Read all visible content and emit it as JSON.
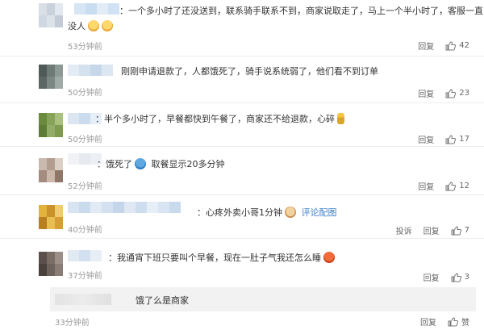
{
  "colors": {
    "link": "#3a7ec8",
    "muted": "#999999",
    "divider": "#eeeeee"
  },
  "comments": [
    {
      "text_a": "：一个多小时了还没送到，联系骑手联系不到，商家说取走了，马上一个半小时了，客服一直",
      "text_b": "没人",
      "emojis": [
        "crying-face-icon",
        "crying-face-icon"
      ],
      "time": "53分钟前",
      "reply": "回复",
      "likes": "42"
    },
    {
      "text_a": "刚刚申请退款了，人都饿死了，骑手说系统弱了，他们看不到订单",
      "time": "50分钟前",
      "reply": "回复",
      "likes": "23"
    },
    {
      "text_a": "：半个多小时了，早餐都快到午餐了，商家还不给退款，心碎",
      "emojis": [
        "candle-icon"
      ],
      "time": "50分钟前",
      "reply": "回复",
      "likes": "17"
    },
    {
      "text_a": "：饿死了",
      "text_b": "取餐显示20多分钟",
      "emojis": [
        "thinking-face-icon"
      ],
      "time": "52分钟前",
      "reply": "回复",
      "likes": "12"
    },
    {
      "text_a": "：心疼外卖小哥1分钟",
      "link": "评论配图",
      "emojis": [
        "dog-icon"
      ],
      "time": "40分钟前",
      "report": "投诉",
      "reply": "回复",
      "likes": "7"
    },
    {
      "text_a": "：我通宵下班只要叫个早餐，现在一肚子气我还怎么睡",
      "emojis": [
        "angry-face-icon"
      ],
      "time": "37分钟前",
      "reply": "回复",
      "likes": "3"
    }
  ],
  "sub_reply": {
    "text": "饿了么是商家",
    "time": "33分钟前",
    "reply": "回复",
    "like": "赞"
  }
}
